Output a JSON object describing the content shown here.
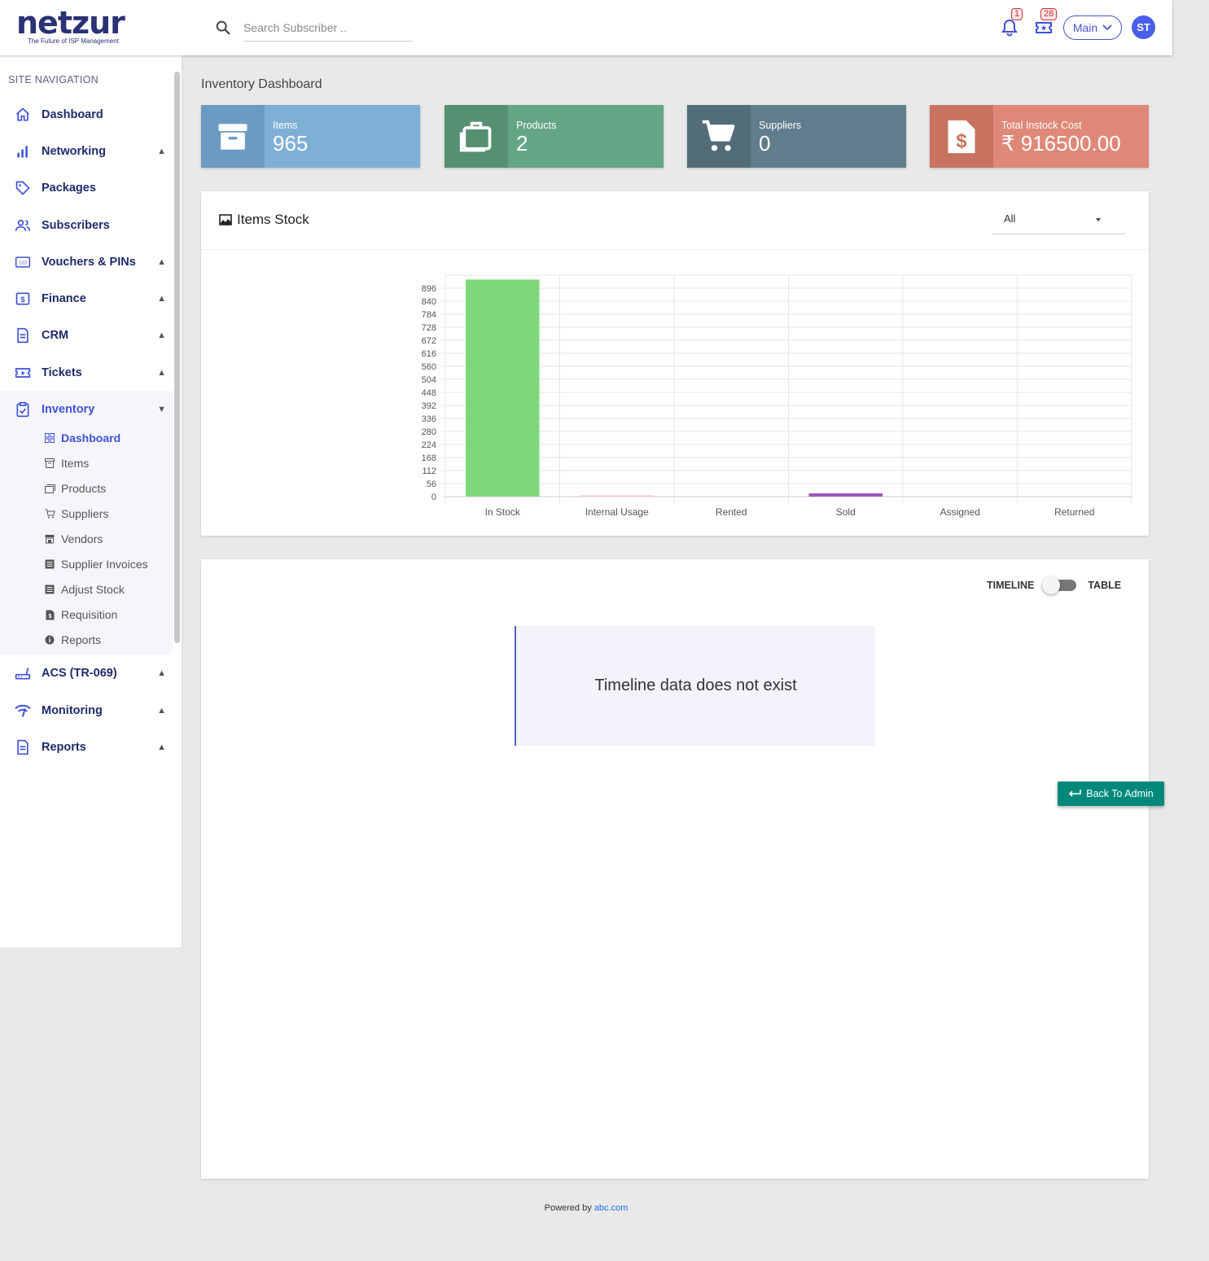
{
  "header": {
    "logo_text": "netzur",
    "logo_tagline": "The Future of ISP Management",
    "search_placeholder": "Search Subscriber ..",
    "notifications_count": "1",
    "tickets_count": "28",
    "main_label": "Main",
    "avatar_initials": "ST"
  },
  "sidebar": {
    "title": "SITE NAVIGATION",
    "items": [
      {
        "label": "Dashboard",
        "icon": "home-icon",
        "arrow": ""
      },
      {
        "label": "Networking",
        "icon": "bar-chart-icon",
        "arrow": "▲"
      },
      {
        "label": "Packages",
        "icon": "tag-icon",
        "arrow": ""
      },
      {
        "label": "Subscribers",
        "icon": "users-icon",
        "arrow": ""
      },
      {
        "label": "Vouchers & PINs",
        "icon": "voucher-icon",
        "arrow": "▲"
      },
      {
        "label": "Finance",
        "icon": "dollar-icon",
        "arrow": "▲"
      },
      {
        "label": "CRM",
        "icon": "document-icon",
        "arrow": "▲"
      },
      {
        "label": "Tickets",
        "icon": "ticket-icon",
        "arrow": "▲"
      },
      {
        "label": "Inventory",
        "icon": "clipboard-check-icon",
        "arrow": "▼"
      },
      {
        "label": "ACS (TR-069)",
        "icon": "router-icon",
        "arrow": "▲"
      },
      {
        "label": "Monitoring",
        "icon": "signal-icon",
        "arrow": "▲"
      },
      {
        "label": "Reports",
        "icon": "report-icon",
        "arrow": "▲"
      }
    ],
    "inventory_sub": [
      {
        "label": "Dashboard",
        "icon": "grid-icon"
      },
      {
        "label": "Items",
        "icon": "archive-icon"
      },
      {
        "label": "Products",
        "icon": "stack-icon"
      },
      {
        "label": "Suppliers",
        "icon": "cart-icon"
      },
      {
        "label": "Vendors",
        "icon": "store-icon"
      },
      {
        "label": "Supplier Invoices",
        "icon": "list-icon"
      },
      {
        "label": "Adjust Stock",
        "icon": "list-icon"
      },
      {
        "label": "Requisition",
        "icon": "file-dollar-icon"
      },
      {
        "label": "Reports",
        "icon": "info-icon"
      }
    ]
  },
  "page": {
    "title": "Inventory Dashboard"
  },
  "cards": [
    {
      "label": "Items",
      "value": "965",
      "icon": "archive-icon",
      "color": "#7eb0d6",
      "icon_bg": "#6b9bc3"
    },
    {
      "label": "Products",
      "value": "2",
      "icon": "briefcase-icon",
      "color": "#64a585",
      "icon_bg": "#559171"
    },
    {
      "label": "Suppliers",
      "value": "0",
      "icon": "cart-icon",
      "color": "#607d8b",
      "icon_bg": "#526c79"
    },
    {
      "label": "Total Instock Cost",
      "value": "₹ 916500.00",
      "icon": "file-dollar-icon",
      "color": "#e08878",
      "icon_bg": "#c8735f"
    }
  ],
  "stock_panel": {
    "title": "Items Stock",
    "filter_value": "All"
  },
  "chart_data": {
    "type": "bar",
    "title": "Items Stock",
    "categories": [
      "In Stock",
      "Internal Usage",
      "Rented",
      "Sold",
      "Assigned",
      "Returned"
    ],
    "values": [
      933,
      2,
      0,
      14,
      0,
      0
    ],
    "colors": [
      "#7dd87a",
      "#f4c6c6",
      "#999999",
      "#9b59b6",
      "#999999",
      "#999999"
    ],
    "yticks": [
      0,
      56,
      112,
      168,
      224,
      280,
      336,
      392,
      448,
      504,
      560,
      616,
      672,
      728,
      784,
      840,
      896
    ],
    "ylim": [
      0,
      952
    ],
    "grid": true
  },
  "timeline": {
    "left_label": "TIMELINE",
    "right_label": "TABLE",
    "empty_message": "Timeline data does not exist"
  },
  "back_button": "Back To Admin",
  "footer": {
    "prefix": "Powered by",
    "link": "abc.com"
  },
  "colors": {
    "accent": "#3f51d8",
    "nav_text": "#1f2b6c",
    "teal": "#00897b"
  }
}
